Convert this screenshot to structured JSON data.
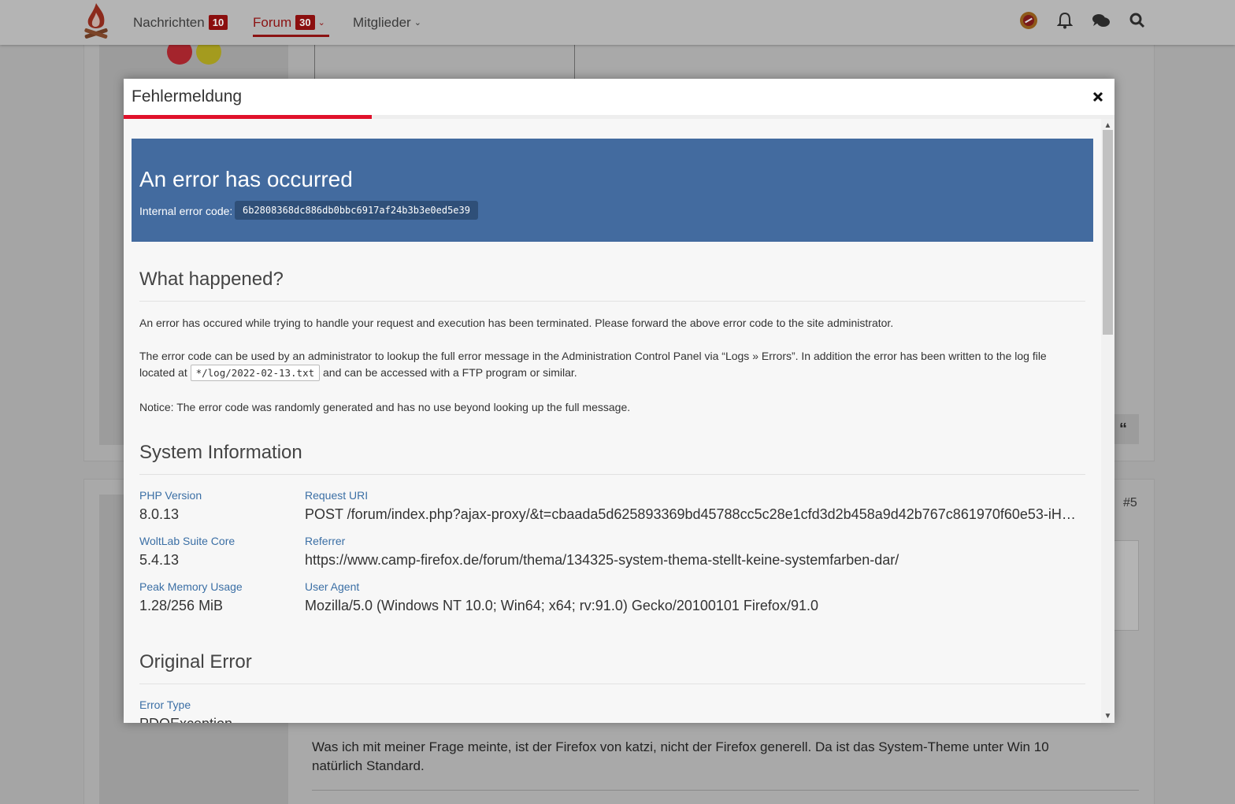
{
  "nav": {
    "messages_label": "Nachrichten",
    "messages_count": "10",
    "forum_label": "Forum",
    "forum_count": "30",
    "members_label": "Mitglieder"
  },
  "background": {
    "post_number": "#5",
    "post_text": "Was ich mit meiner Frage meinte, ist der Firefox von katzi, nicht der Firefox generell. Da ist das System-Theme unter Win 10 natürlich Standard."
  },
  "dialog": {
    "title": "Fehlermeldung",
    "progress_fraction": 0.25
  },
  "error": {
    "title": "An error has occurred",
    "code_label": "Internal error code:",
    "code": "6b2808368dc886db0bbc6917af24b3b3e0ed5e39"
  },
  "what_happened": {
    "title": "What happened?",
    "para1": "An error has occured while trying to handle your request and execution has been terminated. Please forward the above error code to the site administrator.",
    "para2_part1": "The error code can be used by an administrator to lookup the full error message in the Administration Control Panel via “Logs » Errors”. In addition the error has been written to the log file located at ",
    "log_path": "*/log/2022-02-13.txt",
    "para2_part2": " and can be accessed with a FTP program or similar.",
    "para3": "Notice: The error code was randomly generated and has no use beyond looking up the full message."
  },
  "system_info": {
    "title": "System Information",
    "php_label": "PHP Version",
    "php_value": "8.0.13",
    "core_label": "WoltLab Suite Core",
    "core_value": "5.4.13",
    "memory_label": "Peak Memory Usage",
    "memory_value": "1.28/256 MiB",
    "uri_label": "Request URI",
    "uri_value": "POST /forum/index.php?ajax-proxy/&t=cbaada5d625893369bd45788cc5c28e1cfd3d2b458a9d42b767c861970f60e53-iHXw...",
    "referer_label": "Referrer",
    "referer_value": "https://www.camp-firefox.de/forum/thema/134325-system-thema-stellt-keine-systemfarben-dar/",
    "agent_label": "User Agent",
    "agent_value": "Mozilla/5.0 (Windows NT 10.0; Win64; x64; rv:91.0) Gecko/20100101 Firefox/91.0"
  },
  "original_error": {
    "title": "Original Error",
    "type_label": "Error Type",
    "type_value": "PDOException"
  },
  "colors": {
    "accent": "#e0112b",
    "error_box": "#436b9f",
    "link_label": "#3b6fa5"
  }
}
